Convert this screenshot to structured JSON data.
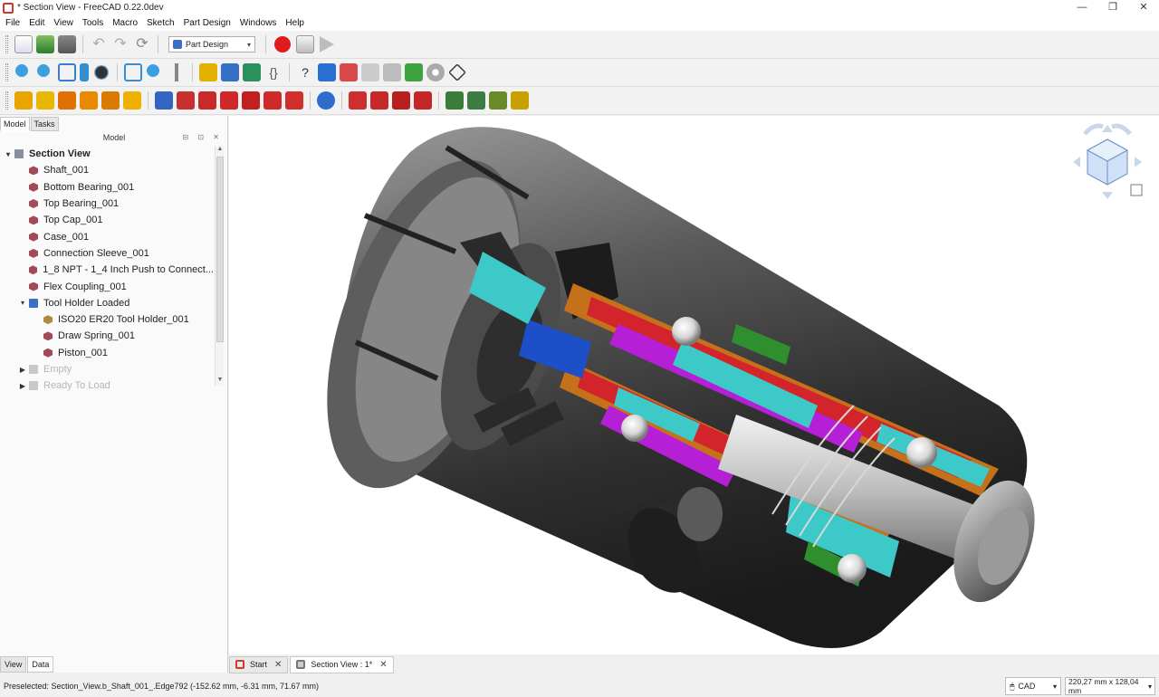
{
  "window": {
    "title": "* Section View - FreeCAD 0.22.0dev",
    "controls": [
      "—",
      "❐",
      "✕"
    ]
  },
  "menu": [
    "File",
    "Edit",
    "View",
    "Tools",
    "Macro",
    "Sketch",
    "Part Design",
    "Windows",
    "Help"
  ],
  "toolbar": {
    "workbench": "Part Design",
    "workbench_arrow": "▾"
  },
  "panel": {
    "tabs": [
      "Model",
      "Tasks"
    ],
    "header": "Model",
    "header_buttons": "⊟ ⊡ ✕",
    "tree": [
      {
        "label": "Section View",
        "level": 0,
        "twisty": "▾",
        "icon": "doc"
      },
      {
        "label": "Shaft_001",
        "level": 1,
        "icon": "body"
      },
      {
        "label": "Bottom Bearing_001",
        "level": 1,
        "icon": "body"
      },
      {
        "label": "Top Bearing_001",
        "level": 1,
        "icon": "body"
      },
      {
        "label": "Top Cap_001",
        "level": 1,
        "icon": "body"
      },
      {
        "label": "Case_001",
        "level": 1,
        "icon": "body"
      },
      {
        "label": "Connection Sleeve_001",
        "level": 1,
        "icon": "body"
      },
      {
        "label": "1_8 NPT - 1_4 Inch Push to Connect...",
        "level": 1,
        "icon": "body"
      },
      {
        "label": "Flex Coupling_001",
        "level": 1,
        "icon": "body"
      },
      {
        "label": "Tool Holder Loaded",
        "level": 1,
        "twisty": "▾",
        "icon": "folder"
      },
      {
        "label": "ISO20 ER20 Tool Holder_001",
        "level": 2,
        "icon": "holder"
      },
      {
        "label": "Draw Spring_001",
        "level": 2,
        "icon": "body"
      },
      {
        "label": "Piston_001",
        "level": 2,
        "icon": "body"
      },
      {
        "label": "Empty",
        "level": 1,
        "twisty": "▶",
        "icon": "folder-dis",
        "disabled": true
      },
      {
        "label": "Ready To Load",
        "level": 1,
        "twisty": "▶",
        "icon": "folder-dis",
        "disabled": true
      }
    ],
    "bottom_tabs": [
      "View",
      "Data"
    ]
  },
  "doc_tabs": [
    {
      "label": "Start",
      "close": "✕"
    },
    {
      "label": "Section View : 1*",
      "close": "✕"
    }
  ],
  "status": {
    "message": "Preselected: Section_View.b_Shaft_001_.Edge792 (-152.62 mm, -6.31 mm, 71.67 mm)",
    "nav_style": "CAD",
    "dimensions": "220,27 mm x 128,04 mm"
  },
  "colors": {
    "record": "#e01b1b",
    "section_red": "#d2242a",
    "section_magenta": "#b51fd6",
    "section_cyan": "#3ec9c9",
    "section_orange": "#c5701b",
    "section_blue": "#1d4fc9",
    "section_green": "#2f8f2f"
  }
}
